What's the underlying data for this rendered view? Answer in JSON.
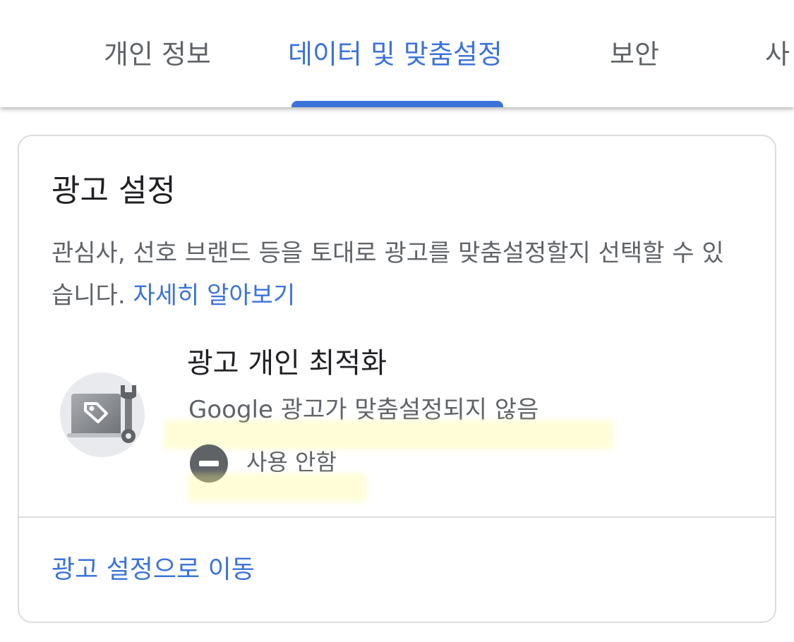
{
  "tabs": [
    {
      "label": "개인 정보",
      "active": false
    },
    {
      "label": "데이터 및 맞춤설정",
      "active": true
    },
    {
      "label": "보안",
      "active": false
    },
    {
      "label": "사",
      "active": false
    }
  ],
  "card": {
    "title": "광고 설정",
    "description": "관심사, 선호 브랜드 등을 토대로 광고를 맞춤설정할지 선택할 수 있습니다.",
    "learn_more": "자세히 알아보기",
    "setting": {
      "icon": "ad-tag-wrench-icon",
      "title": "광고 개인 최적화",
      "subtitle": "Google 광고가 맞춤설정되지 않음",
      "status_icon": "minus-circle-icon",
      "status": "사용 안함"
    },
    "footer_link": "광고 설정으로 이동"
  },
  "colors": {
    "accent": "#3b73d9",
    "text_primary": "#202124",
    "text_secondary": "#5f6368",
    "border": "#dadce0"
  }
}
